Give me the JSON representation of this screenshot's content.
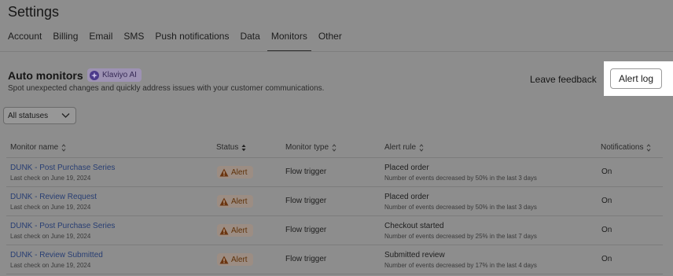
{
  "page": {
    "title": "Settings"
  },
  "tabs": [
    {
      "label": "Account"
    },
    {
      "label": "Billing"
    },
    {
      "label": "Email"
    },
    {
      "label": "SMS"
    },
    {
      "label": "Push notifications"
    },
    {
      "label": "Data"
    },
    {
      "label": "Monitors",
      "active": true
    },
    {
      "label": "Other"
    }
  ],
  "section": {
    "title": "Auto monitors",
    "badge": "Klaviyo AI",
    "description": "Spot unexpected changes and quickly address issues with your customer communications."
  },
  "actions": {
    "feedback": "Leave feedback",
    "alert_log": "Alert log"
  },
  "filter": {
    "selected": "All statuses"
  },
  "table": {
    "columns": {
      "name": "Monitor name",
      "status": "Status",
      "type": "Monitor type",
      "rule": "Alert rule",
      "notifications": "Notifications"
    },
    "rows": [
      {
        "name": "DUNK - Post Purchase Series",
        "last_check": "Last check on June 19, 2024",
        "status": "Alert",
        "type": "Flow trigger",
        "rule": "Placed order",
        "rule_detail": "Number of events decreased by 50% in the last 3 days",
        "notifications": "On"
      },
      {
        "name": "DUNK - Review Request",
        "last_check": "Last check on June 19, 2024",
        "status": "Alert",
        "type": "Flow trigger",
        "rule": "Placed order",
        "rule_detail": "Number of events decreased by 50% in the last 3 days",
        "notifications": "On"
      },
      {
        "name": "DUNK - Post Purchase Series",
        "last_check": "Last check on June 19, 2024",
        "status": "Alert",
        "type": "Flow trigger",
        "rule": "Checkout started",
        "rule_detail": "Number of events decreased by 25% in the last 7 days",
        "notifications": "On"
      },
      {
        "name": "DUNK - Review Submitted",
        "last_check": "Last check on June 19, 2024",
        "status": "Alert",
        "type": "Flow trigger",
        "rule": "Submitted review",
        "rule_detail": "Number of events decreased by 17% in the last 4 days",
        "notifications": "On"
      }
    ]
  },
  "colors": {
    "overlay": "#8d8d8d",
    "link": "#283e73",
    "alert_bg": "#9c8d83",
    "alert_text": "#5e3108",
    "highlight": "#ffffff"
  }
}
